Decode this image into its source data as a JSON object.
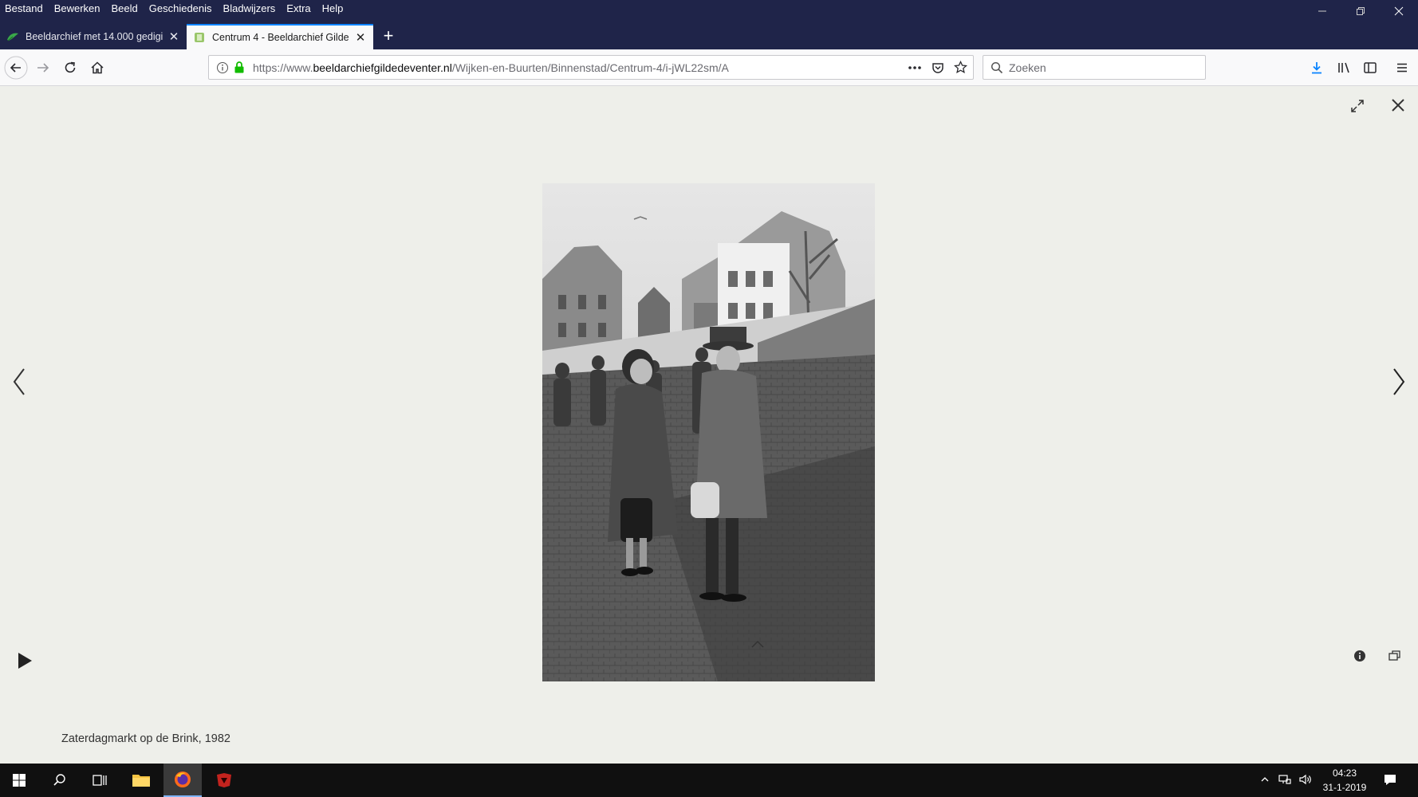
{
  "menu": [
    "Bestand",
    "Bewerken",
    "Beeld",
    "Geschiedenis",
    "Bladwijzers",
    "Extra",
    "Help"
  ],
  "tabs": [
    {
      "label": "Beeldarchief met 14.000 gedigi",
      "active": false
    },
    {
      "label": "Centrum 4 - Beeldarchief Gilde",
      "active": true
    }
  ],
  "url": {
    "prefix": "https://www.",
    "host": "beeldarchiefgildedeventer.nl",
    "path": "/Wijken-en-Buurten/Binnenstad/Centrum-4/i-jWL22sm/A"
  },
  "search": {
    "placeholder": "Zoeken"
  },
  "viewer": {
    "caption": "Zaterdagmarkt op de Brink, 1982",
    "icons": [
      "fullscreen-icon",
      "close-icon",
      "prev-arrow-icon",
      "next-arrow-icon",
      "play-icon",
      "expand-up-icon",
      "info-icon",
      "share-icon"
    ]
  },
  "taskbar": {
    "time": "04:23",
    "date": "31-1-2019"
  },
  "colors": {
    "chrome_dark": "#1f2449",
    "viewer_bg": "#eeefea",
    "accent": "#0a84ff"
  }
}
